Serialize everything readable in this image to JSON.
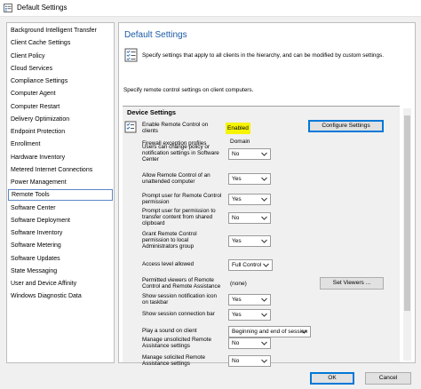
{
  "window": {
    "title": "Default Settings"
  },
  "sidebar": {
    "items": [
      {
        "label": "Background Intelligent Transfer"
      },
      {
        "label": "Client Cache Settings"
      },
      {
        "label": "Client Policy"
      },
      {
        "label": "Cloud Services"
      },
      {
        "label": "Compliance Settings"
      },
      {
        "label": "Computer Agent"
      },
      {
        "label": "Computer Restart"
      },
      {
        "label": "Delivery Optimization"
      },
      {
        "label": "Endpoint Protection"
      },
      {
        "label": "Enrollment"
      },
      {
        "label": "Hardware Inventory"
      },
      {
        "label": "Metered Internet Connections"
      },
      {
        "label": "Power Management"
      },
      {
        "label": "Remote Tools",
        "selected": true
      },
      {
        "label": "Software Center"
      },
      {
        "label": "Software Deployment"
      },
      {
        "label": "Software Inventory"
      },
      {
        "label": "Software Metering"
      },
      {
        "label": "Software Updates"
      },
      {
        "label": "State Messaging"
      },
      {
        "label": "User and Device Affinity"
      },
      {
        "label": "Windows Diagnostic Data"
      }
    ]
  },
  "content": {
    "page_title": "Default Settings",
    "description": "Specify settings that apply to all clients in the hierarchy, and can be modified by custom settings.",
    "subdescription": "Specify remote control settings on client computers.",
    "group_header": "Device Settings",
    "enable_label_1": "Enable Remote Control on",
    "enable_label_2": "clients",
    "enable_status": "Enabled",
    "configure_button": "Configure Settings",
    "firewall_label": "Firewall exception profiles",
    "firewall_value": "Domain",
    "settings": [
      {
        "label": [
          "Users can change policy or",
          "notification settings in Software",
          "Center"
        ],
        "value": "No"
      },
      {
        "label": [
          "Allow Remote Control of an",
          "unattended computer"
        ],
        "value": "Yes"
      },
      {
        "label": [
          "Prompt user for Remote Control",
          "permission"
        ],
        "value": "Yes"
      },
      {
        "label": [
          "Prompt user for permission to",
          "transfer content from shared",
          "clipboard"
        ],
        "value": "No"
      },
      {
        "label": [
          "Grant Remote Control",
          "permission to local",
          "Administrators group"
        ],
        "value": "Yes"
      },
      {
        "label": [
          "Access level allowed"
        ],
        "value": "Full Control"
      },
      {
        "label": [
          "Show session notification icon",
          "on taskbar"
        ],
        "value": "Yes"
      },
      {
        "label": [
          "Show session connection bar"
        ],
        "value": "Yes"
      },
      {
        "label": [
          "Play a sound on client"
        ],
        "value": "Beginning and end of session"
      },
      {
        "label": [
          "Manage unsolicited Remote",
          "Assistance settings"
        ],
        "value": "No"
      },
      {
        "label": [
          "Manage solicited Remote",
          "Assistance settings"
        ],
        "value": "No"
      }
    ],
    "permitted_label": [
      "Permitted viewers of Remote",
      "Control and Remote Assistance"
    ],
    "permitted_value": "(none)",
    "set_viewers_button": "Set Viewers ..."
  },
  "footer": {
    "ok": "OK",
    "cancel": "Cancel"
  },
  "colors": {
    "accent": "#1a5aa6",
    "highlight": "#f6f400",
    "selection_border": "#5b87c5"
  },
  "icons": {
    "window": "settings-window-icon",
    "header": "checklist-icon",
    "enable": "remote-control-icon",
    "dropdown": "chevron-down-icon"
  }
}
